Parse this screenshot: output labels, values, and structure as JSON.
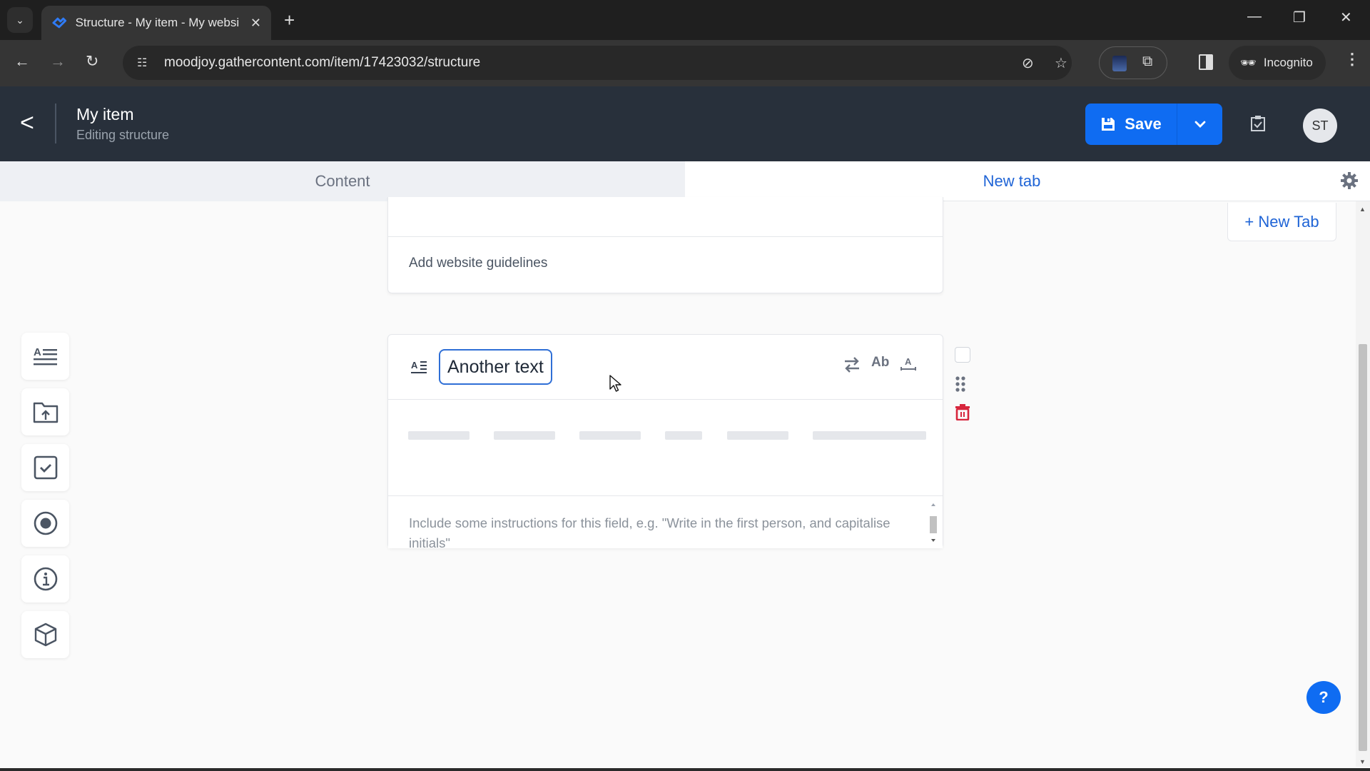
{
  "browser": {
    "tab_title": "Structure - My item - My websi",
    "url": "moodjoy.gathercontent.com/item/17423032/structure",
    "incognito_label": "Incognito",
    "icons": [
      "tab-search-icon",
      "favicon",
      "close-tab-icon",
      "new-tab-icon",
      "minimize-icon",
      "restore-icon",
      "close-window-icon",
      "back-icon",
      "forward-icon",
      "reload-icon",
      "site-settings-icon",
      "eye-off-icon",
      "star-icon",
      "extension-icon",
      "puzzle-icon",
      "side-panel-icon",
      "incognito-icon",
      "menu-icon"
    ]
  },
  "header": {
    "title": "My item",
    "subtitle": "Editing structure",
    "save_label": "Save",
    "avatar_initials": "ST"
  },
  "tabs": [
    {
      "label": "Content",
      "active": false
    },
    {
      "label": "New tab",
      "active": true
    }
  ],
  "new_tab_button": "+ New Tab",
  "card1": {
    "guidelines_label": "Add website guidelines"
  },
  "card2": {
    "field_name": "Another text",
    "action_ab_label": "Ab",
    "action_a_label": "A",
    "instructions_placeholder": "Include some instructions for this field, e.g. \"Write in the first person, and capitalise initials\""
  },
  "palette": [
    {
      "name": "text-field-icon"
    },
    {
      "name": "file-upload-icon"
    },
    {
      "name": "checkbox-icon"
    },
    {
      "name": "radio-icon"
    },
    {
      "name": "guidelines-icon"
    },
    {
      "name": "component-icon"
    }
  ],
  "help_label": "?",
  "colors": {
    "primary": "#0f6cf2",
    "header_bg": "#28303b",
    "tab_active": "#1f64d6",
    "delete": "#d7263d"
  }
}
